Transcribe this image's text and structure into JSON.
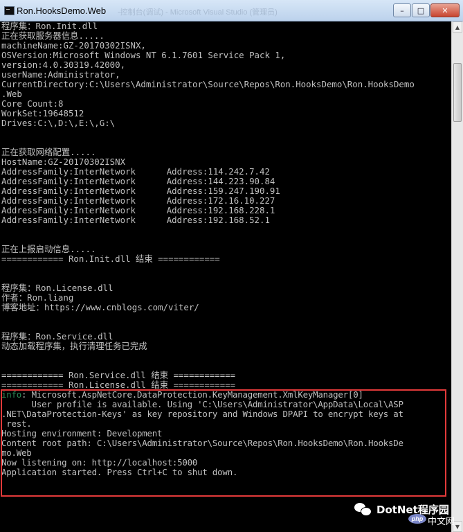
{
  "window": {
    "title": "Ron.HooksDemo.Web",
    "ghost_title": "-控制台(调试) - Microsoft Visual Studio (管理员)",
    "buttons": {
      "minimize": "–",
      "maximize": "□",
      "close": "✕"
    },
    "icons": {
      "app": "console-icon",
      "scroll_up": "arrow-up-icon",
      "scroll_down": "arrow-down-icon"
    }
  },
  "console": {
    "colors": {
      "text": "#c0c0c0",
      "info": "#2e8b57",
      "highlight_border": "#e23a3a",
      "background": "#000000"
    },
    "lines": [
      {
        "text": "程序集：Ron.Init.dll"
      },
      {
        "text": "正在获取服务器信息....."
      },
      {
        "text": "machineName:GZ-20170302ISNX,"
      },
      {
        "text": "OSVersion:Microsoft Windows NT 6.1.7601 Service Pack 1,"
      },
      {
        "text": "version:4.0.30319.42000,"
      },
      {
        "text": "userName:Administrator,"
      },
      {
        "text": "CurrentDirectory:C:\\Users\\Administrator\\Source\\Repos\\Ron.HooksDemo\\Ron.HooksDemo"
      },
      {
        "text": ".Web"
      },
      {
        "text": "Core Count:8"
      },
      {
        "text": "WorkSet:19648512"
      },
      {
        "text": "Drives:C:\\,D:\\,E:\\,G:\\"
      },
      {
        "text": ""
      },
      {
        "text": ""
      },
      {
        "text": "正在获取网络配置....."
      },
      {
        "text": "HostName:GZ-20170302ISNX"
      },
      {
        "text": "AddressFamily:InterNetwork      Address:114.242.7.42"
      },
      {
        "text": "AddressFamily:InterNetwork      Address:144.223.90.84"
      },
      {
        "text": "AddressFamily:InterNetwork      Address:159.247.190.91"
      },
      {
        "text": "AddressFamily:InterNetwork      Address:172.16.10.227"
      },
      {
        "text": "AddressFamily:InterNetwork      Address:192.168.228.1"
      },
      {
        "text": "AddressFamily:InterNetwork      Address:192.168.52.1"
      },
      {
        "text": ""
      },
      {
        "text": ""
      },
      {
        "text": "正在上报启动信息....."
      },
      {
        "text": "============ Ron.Init.dll 结束 ============"
      },
      {
        "text": ""
      },
      {
        "text": ""
      },
      {
        "text": "程序集：Ron.License.dll"
      },
      {
        "text": "作者：Ron.liang"
      },
      {
        "text": "博客地址：https://www.cnblogs.com/viter/"
      },
      {
        "text": ""
      },
      {
        "text": ""
      },
      {
        "text": "程序集：Ron.Service.dll"
      },
      {
        "text": "动态加载程序集，执行清理任务已完成"
      },
      {
        "text": ""
      },
      {
        "text": ""
      },
      {
        "text": "============ Ron.Service.dll 结束 ============"
      },
      {
        "text": "============ Ron.License.dll 结束 ============"
      }
    ],
    "highlighted_lines": [
      {
        "tag": "info",
        "text": ": Microsoft.AspNetCore.DataProtection.KeyManagement.XmlKeyManager[0]"
      },
      {
        "tag": "",
        "text": "      User profile is available. Using 'C:\\Users\\Administrator\\AppData\\Local\\ASP"
      },
      {
        "tag": "",
        "text": ".NET\\DataProtection-Keys' as key repository and Windows DPAPI to encrypt keys at"
      },
      {
        "tag": "",
        "text": " rest."
      },
      {
        "tag": "",
        "text": "Hosting environment: Development"
      },
      {
        "tag": "",
        "text": "Content root path: C:\\Users\\Administrator\\Source\\Repos\\Ron.HooksDemo\\Ron.HooksDe"
      },
      {
        "tag": "",
        "text": "mo.Web"
      },
      {
        "tag": "",
        "text": "Now listening on: http://localhost:5000"
      },
      {
        "tag": "",
        "text": "Application started. Press Ctrl+C to shut down."
      }
    ]
  },
  "watermark": {
    "text": "DotNet程序园",
    "php_badge": "php",
    "php_suffix": "中文网",
    "icon": "wechat-icon"
  }
}
